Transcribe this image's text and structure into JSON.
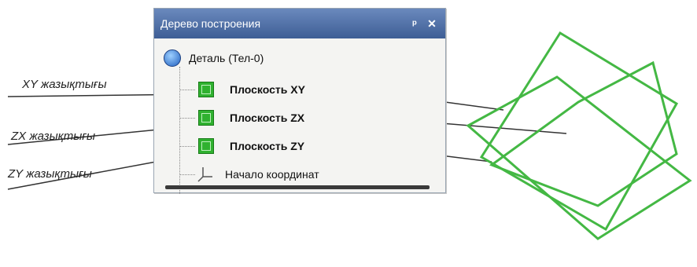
{
  "panel": {
    "title": "Дерево построения",
    "pin_icon": "pin-icon",
    "close_icon": "close-icon"
  },
  "tree": {
    "root": {
      "label": "Деталь (Тел-0)",
      "icon": "part-icon"
    },
    "items": [
      {
        "label": "Плоскость XY",
        "icon": "plane-icon"
      },
      {
        "label": "Плоскость ZX",
        "icon": "plane-icon"
      },
      {
        "label": "Плоскость ZY",
        "icon": "plane-icon"
      },
      {
        "label": "Начало координат",
        "icon": "origin-icon"
      }
    ]
  },
  "callouts": [
    {
      "label": "XY жазықтығы"
    },
    {
      "label": "ZX жазықтығы"
    },
    {
      "label": "ZY жазықтығы"
    }
  ],
  "colors": {
    "plane_green": "#2fb12f",
    "titlebar": "#4a6aa5"
  }
}
